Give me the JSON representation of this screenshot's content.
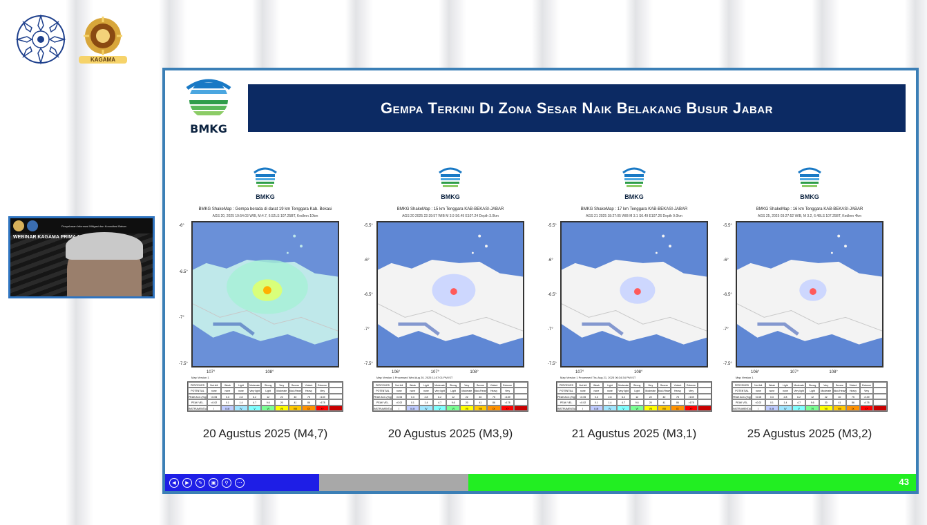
{
  "top_logos": {
    "logo1_icon": "ugm-emblem-icon",
    "logo2_icon": "kagama-emblem-icon",
    "kagama_label": "KAGAMA"
  },
  "webcam": {
    "title": "WEBINAR KAGAMA PRIMA 12",
    "banner_text": "Penyebaran Informasi Mitigasi dan Konsultasi Bahan"
  },
  "slide": {
    "org_logo_text": "BMKG",
    "title": "Gempa Terkini Di Zona Sesar Naik Belakang Busur Jabar",
    "page_number": "43",
    "cards": [
      {
        "logo_text": "BMKG",
        "caption": "BMKG ShakeMap : Gempa berada di darat 19 km Tenggara Kab. Bekasi",
        "subcaption": "AGS 20, 2025 19:54:03 WIB, M:4.7, 6.52LS 107.25BT, Kedlmn 10km",
        "date_label": "20 Agustus 2025 (M4,7)",
        "lat_labels": [
          "-6°",
          "-6.5°",
          "-7°",
          "-7.5°"
        ],
        "lon_labels": [
          "107°",
          "108°"
        ],
        "map_version": "Map Version 1"
      },
      {
        "logo_text": "BMKG",
        "caption": "BMKG ShakeMap : 15 km Tenggara KAB-BEKASI-JABAR",
        "subcaption": "AGS 20 2025 22:39:57 WIB M 3.9 S6.49 E107.24 Depth 3.0km",
        "date_label": "20 Agustus 2025 (M3,9)",
        "lat_labels": [
          "-5.5°",
          "-6°",
          "-6.5°",
          "-7°",
          "-7.5°"
        ],
        "lon_labels": [
          "106°",
          "107°",
          "108°"
        ],
        "map_version": "Map Version 1 Processed Wed Aug 20, 2025 11:07:01 PM IST"
      },
      {
        "logo_text": "BMKG",
        "caption": "BMKG ShakeMap : 17 km Tenggara KAB-BEKASI-JABAR",
        "subcaption": "AGS 21 2025 18:27:05 WIB M 3.1 S6.49 E107.26 Depth 9.0km",
        "date_label": "21 Agustus 2025 (M3,1)",
        "lat_labels": [
          "-5.5°",
          "-6°",
          "-6.5°",
          "-7°",
          "-7.5°"
        ],
        "lon_labels": [
          "107°",
          "108°"
        ],
        "map_version": "Map Version 1 Processed Thu Aug 21, 2025 06:34:34 PM IST"
      },
      {
        "logo_text": "BMKG",
        "caption": "BMKG ShakeMap : 16 km Tenggara KAB-BEKASI-JABAR",
        "subcaption": "AGS 25, 2025 03:27:52 WIB, M 3.2, 6.48LS 107.25BT, Kedlmn 4km",
        "date_label": "25 Agustus 2025 (M3,2)",
        "lat_labels": [
          "-5.5°",
          "-6°",
          "-6.5°",
          "-7°",
          "-7.5°"
        ],
        "lon_labels": [
          "106°",
          "107°",
          "108°"
        ],
        "map_version": "Map Version 1"
      }
    ],
    "legend": {
      "row_labels": [
        "PERCEIVED SHAKING",
        "POTENTIAL DAMAGE",
        "PEAK ACC.(%g)",
        "PEAK VEL.(cm/s)",
        "INSTRUMENTAL INTENSITY"
      ],
      "shaking": [
        "Not felt",
        "Weak",
        "Light",
        "Moderate",
        "Strong",
        "Very strong",
        "Severe",
        "Violent",
        "Extreme",
        ""
      ],
      "damage": [
        "none",
        "none",
        "none",
        "Very light",
        "Light",
        "Moderate",
        "Mod./Heavy",
        "Heavy",
        "Very Heavy",
        ""
      ],
      "acc": [
        "<0.05",
        "0.3",
        "2.8",
        "6.2",
        "12",
        "22",
        "40",
        "75",
        ">139",
        ""
      ],
      "vel": [
        "<0.02",
        "0.1",
        "1.4",
        "4.7",
        "9.6",
        "20",
        "41",
        "86",
        ">178",
        ""
      ],
      "intensity": [
        "I",
        "II-III",
        "IV",
        "V",
        "VI",
        "VII",
        "VIII",
        "IX",
        "X+",
        ""
      ],
      "intensity_colors": [
        "#ffffff",
        "#bfccff",
        "#a0e6ff",
        "#80ffff",
        "#7aff93",
        "#ffff00",
        "#ffc800",
        "#ff9100",
        "#ff0000",
        "#c80000"
      ]
    },
    "nav_icons": [
      "prev-icon",
      "next-icon",
      "pen-icon",
      "pages-icon",
      "zoom-icon",
      "more-icon"
    ]
  }
}
